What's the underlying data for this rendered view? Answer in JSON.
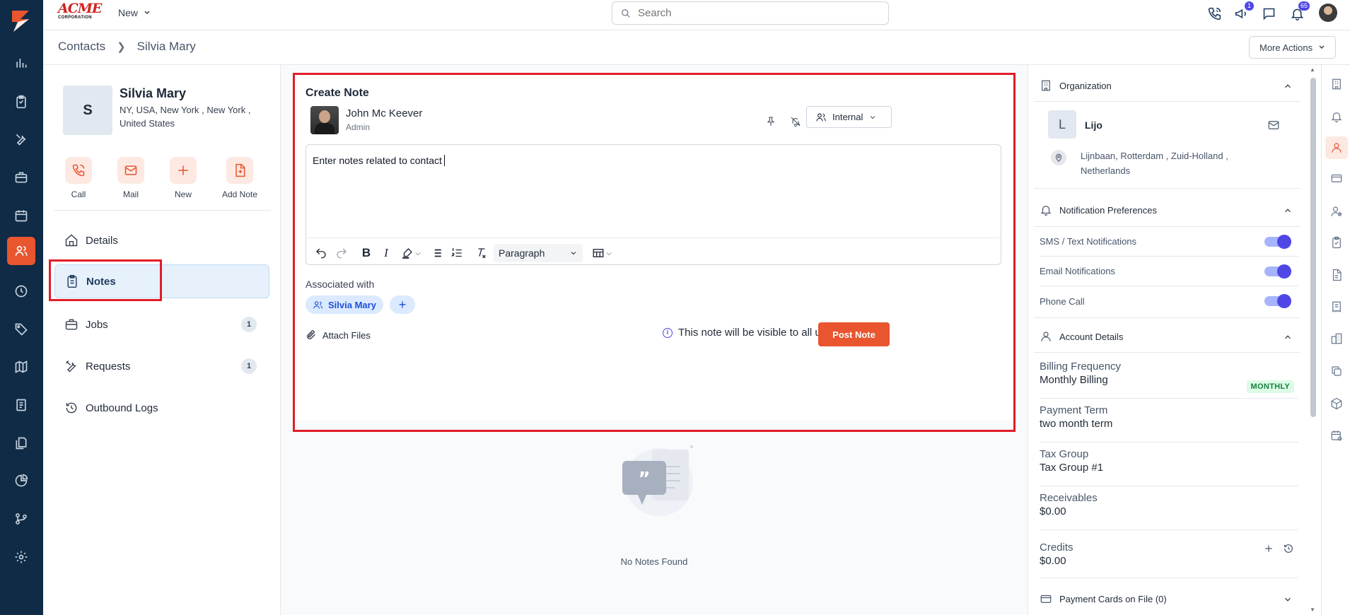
{
  "app": {
    "brand_name": "ACME",
    "brand_sub": "CORPORATION",
    "new_menu_label": "New",
    "search_placeholder": "Search",
    "header_badges": {
      "announcements": "1",
      "notifications": "65"
    },
    "accent_color": "#e8552f",
    "rail_color": "#0f2b46"
  },
  "rail_items": [
    {
      "icon": "dashboard-chart-icon"
    },
    {
      "icon": "clipboard-icon"
    },
    {
      "icon": "tools-icon"
    },
    {
      "icon": "briefcase-icon"
    },
    {
      "icon": "calendar-icon"
    },
    {
      "icon": "contacts-icon",
      "active": true
    },
    {
      "icon": "clock-icon"
    },
    {
      "icon": "tag-icon"
    },
    {
      "icon": "map-icon"
    },
    {
      "icon": "invoice-icon"
    },
    {
      "icon": "documents-icon"
    },
    {
      "icon": "pie-chart-icon"
    },
    {
      "icon": "workflow-icon"
    },
    {
      "icon": "settings-icon"
    }
  ],
  "breadcrumb": {
    "root": "Contacts",
    "current": "Silvia Mary"
  },
  "more_actions_label": "More Actions",
  "contact": {
    "initial": "S",
    "name": "Silvia Mary",
    "address": "NY, USA, New York , New York , United States"
  },
  "quick_actions": [
    {
      "label": "Call",
      "icon": "phone-icon"
    },
    {
      "label": "Mail",
      "icon": "mail-icon"
    },
    {
      "label": "New",
      "icon": "plus-icon"
    },
    {
      "label": "Add Note",
      "icon": "add-note-icon"
    }
  ],
  "nav": {
    "details": "Details",
    "notes": "Notes",
    "jobs": "Jobs",
    "jobs_count": "1",
    "requests": "Requests",
    "requests_count": "1",
    "outbound_logs": "Outbound Logs"
  },
  "note_form": {
    "title": "Create Note",
    "author_name": "John Mc Keever",
    "author_role": "Admin",
    "visibility_option": "Internal",
    "editor_value": "Enter notes related to contact",
    "block_format": "Paragraph",
    "associated_label": "Associated with",
    "associated_chip": "Silvia Mary",
    "attach_label": "Attach Files",
    "visibility_notice": "This note will be visible to all users",
    "post_label": "Post Note"
  },
  "empty_state": {
    "text": "No Notes Found"
  },
  "organization": {
    "section_title": "Organization",
    "initial": "L",
    "name": "Lijo",
    "address": "Lijnbaan, Rotterdam , Zuid-Holland , Netherlands"
  },
  "notification_prefs": {
    "section_title": "Notification Preferences",
    "items": [
      {
        "label": "SMS / Text Notifications",
        "enabled": true
      },
      {
        "label": "Email Notifications",
        "enabled": true
      },
      {
        "label": "Phone Call",
        "enabled": true
      }
    ]
  },
  "account_details": {
    "section_title": "Account Details",
    "billing_frequency_label": "Billing Frequency",
    "billing_frequency_value": "Monthly Billing",
    "billing_badge": "MONTHLY",
    "payment_term_label": "Payment Term",
    "payment_term_value": "two month term",
    "tax_group_label": "Tax Group",
    "tax_group_value": "Tax Group #1",
    "receivables_label": "Receivables",
    "receivables_value": "$0.00",
    "credits_label": "Credits",
    "credits_value": "$0.00"
  },
  "payment_cards": {
    "section_title": "Payment Cards on File (0)"
  },
  "side_icons": [
    "building-icon",
    "bell-settings-icon",
    "contact-person-icon",
    "credit-card-icon",
    "user-star-icon",
    "clipboard-check-icon",
    "document-icon",
    "receipt-icon",
    "office-building-icon",
    "copy-icon",
    "box-icon",
    "calendar-settings-icon"
  ]
}
